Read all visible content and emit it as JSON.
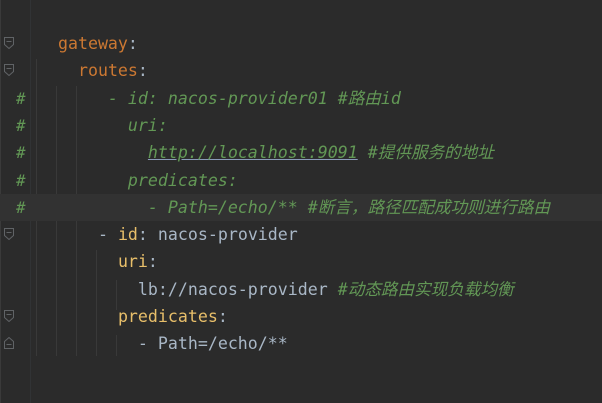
{
  "editor": {
    "colors": {
      "background": "#2b2b2b",
      "key": "#cc7832",
      "value": "#a9b7c6",
      "comment": "#629755",
      "current_line": "#323232"
    },
    "lines": [
      {
        "commented": false,
        "fold": "open",
        "tokens": [
          {
            "t": "  ",
            "k": "val"
          },
          {
            "t": "gateway",
            "k": "key"
          },
          {
            "t": ":",
            "k": "punct"
          }
        ]
      },
      {
        "commented": false,
        "fold": "open",
        "tokens": [
          {
            "t": "    ",
            "k": "val"
          },
          {
            "t": "routes",
            "k": "key"
          },
          {
            "t": ":",
            "k": "punct"
          }
        ]
      },
      {
        "commented": true,
        "hash": "#",
        "tokens": [
          {
            "t": "       - id: nacos-provider01 #路由id",
            "k": "comment"
          }
        ]
      },
      {
        "commented": true,
        "hash": "#",
        "tokens": [
          {
            "t": "         uri:",
            "k": "comment"
          }
        ]
      },
      {
        "commented": true,
        "hash": "#",
        "tokens": [
          {
            "t": "           ",
            "k": "comment"
          },
          {
            "t": "http://localhost:9091",
            "k": "url"
          },
          {
            "t": " #提供服务的地址",
            "k": "comment"
          }
        ]
      },
      {
        "commented": true,
        "hash": "#",
        "tokens": [
          {
            "t": "         predicates:",
            "k": "comment"
          }
        ]
      },
      {
        "commented": true,
        "hash": "#",
        "current": true,
        "tokens": [
          {
            "t": "           - Path=/echo/** #断言，路径匹配成功则进行路由",
            "k": "comment"
          }
        ]
      },
      {
        "commented": false,
        "fold": "open",
        "tokens": [
          {
            "t": "      - ",
            "k": "val"
          },
          {
            "t": "id",
            "k": "key2"
          },
          {
            "t": ": nacos-provider",
            "k": "val"
          }
        ]
      },
      {
        "commented": false,
        "tokens": [
          {
            "t": "        ",
            "k": "val"
          },
          {
            "t": "uri",
            "k": "key2"
          },
          {
            "t": ":",
            "k": "punct"
          }
        ]
      },
      {
        "commented": false,
        "tokens": [
          {
            "t": "          lb://nacos-provider ",
            "k": "val"
          },
          {
            "t": "#动态路由实现负载均衡",
            "k": "comment"
          }
        ]
      },
      {
        "commented": false,
        "fold": "open",
        "tokens": [
          {
            "t": "        ",
            "k": "val"
          },
          {
            "t": "predicates",
            "k": "key2"
          },
          {
            "t": ":",
            "k": "punct"
          }
        ]
      },
      {
        "commented": false,
        "fold": "end",
        "tokens": [
          {
            "t": "          - Path=/echo/**",
            "k": "val"
          }
        ]
      }
    ]
  }
}
